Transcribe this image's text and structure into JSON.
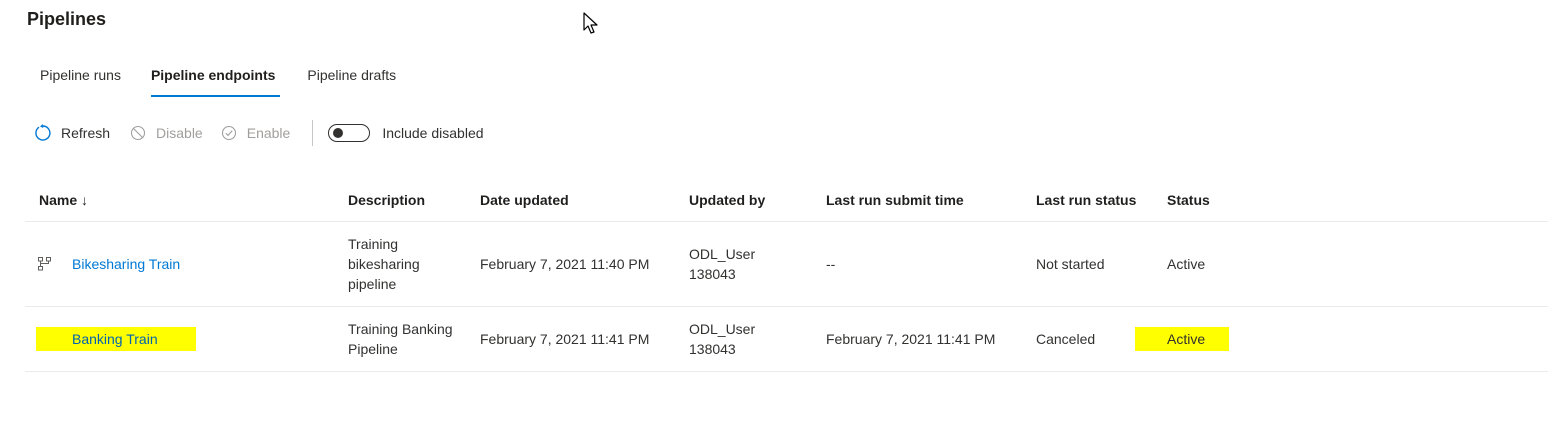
{
  "page": {
    "title": "Pipelines"
  },
  "tabs": [
    {
      "label": "Pipeline runs",
      "active": false
    },
    {
      "label": "Pipeline endpoints",
      "active": true
    },
    {
      "label": "Pipeline drafts",
      "active": false
    }
  ],
  "toolbar": {
    "refresh_label": "Refresh",
    "disable_label": "Disable",
    "enable_label": "Enable",
    "include_disabled_label": "Include disabled",
    "include_disabled_on": false
  },
  "table": {
    "columns": [
      "Name ↓",
      "Description",
      "Date updated",
      "Updated by",
      "Last run submit time",
      "Last run status",
      "Status"
    ],
    "rows": [
      {
        "name": "Bikesharing Train",
        "description": "Training bikesharing pipeline",
        "date_updated": "February 7, 2021 11:40 PM",
        "updated_by": "ODL_User 138043",
        "last_run_submit_time": "--",
        "last_run_status": "Not started",
        "status": "Active"
      },
      {
        "name": "Banking Train",
        "description": "Training Banking Pipeline",
        "date_updated": "February 7, 2021 11:41 PM",
        "updated_by": "ODL_User 138043",
        "last_run_submit_time": "February 7, 2021 11:41 PM",
        "last_run_status": "Canceled",
        "status": "Active"
      }
    ]
  },
  "colors": {
    "accent": "#0078d4",
    "highlight": "#ffff00",
    "disabled_text": "#a19f9d"
  },
  "icons": [
    "refresh-icon",
    "disable-icon",
    "enable-icon",
    "pipeline-icon",
    "mouse-cursor-icon"
  ]
}
